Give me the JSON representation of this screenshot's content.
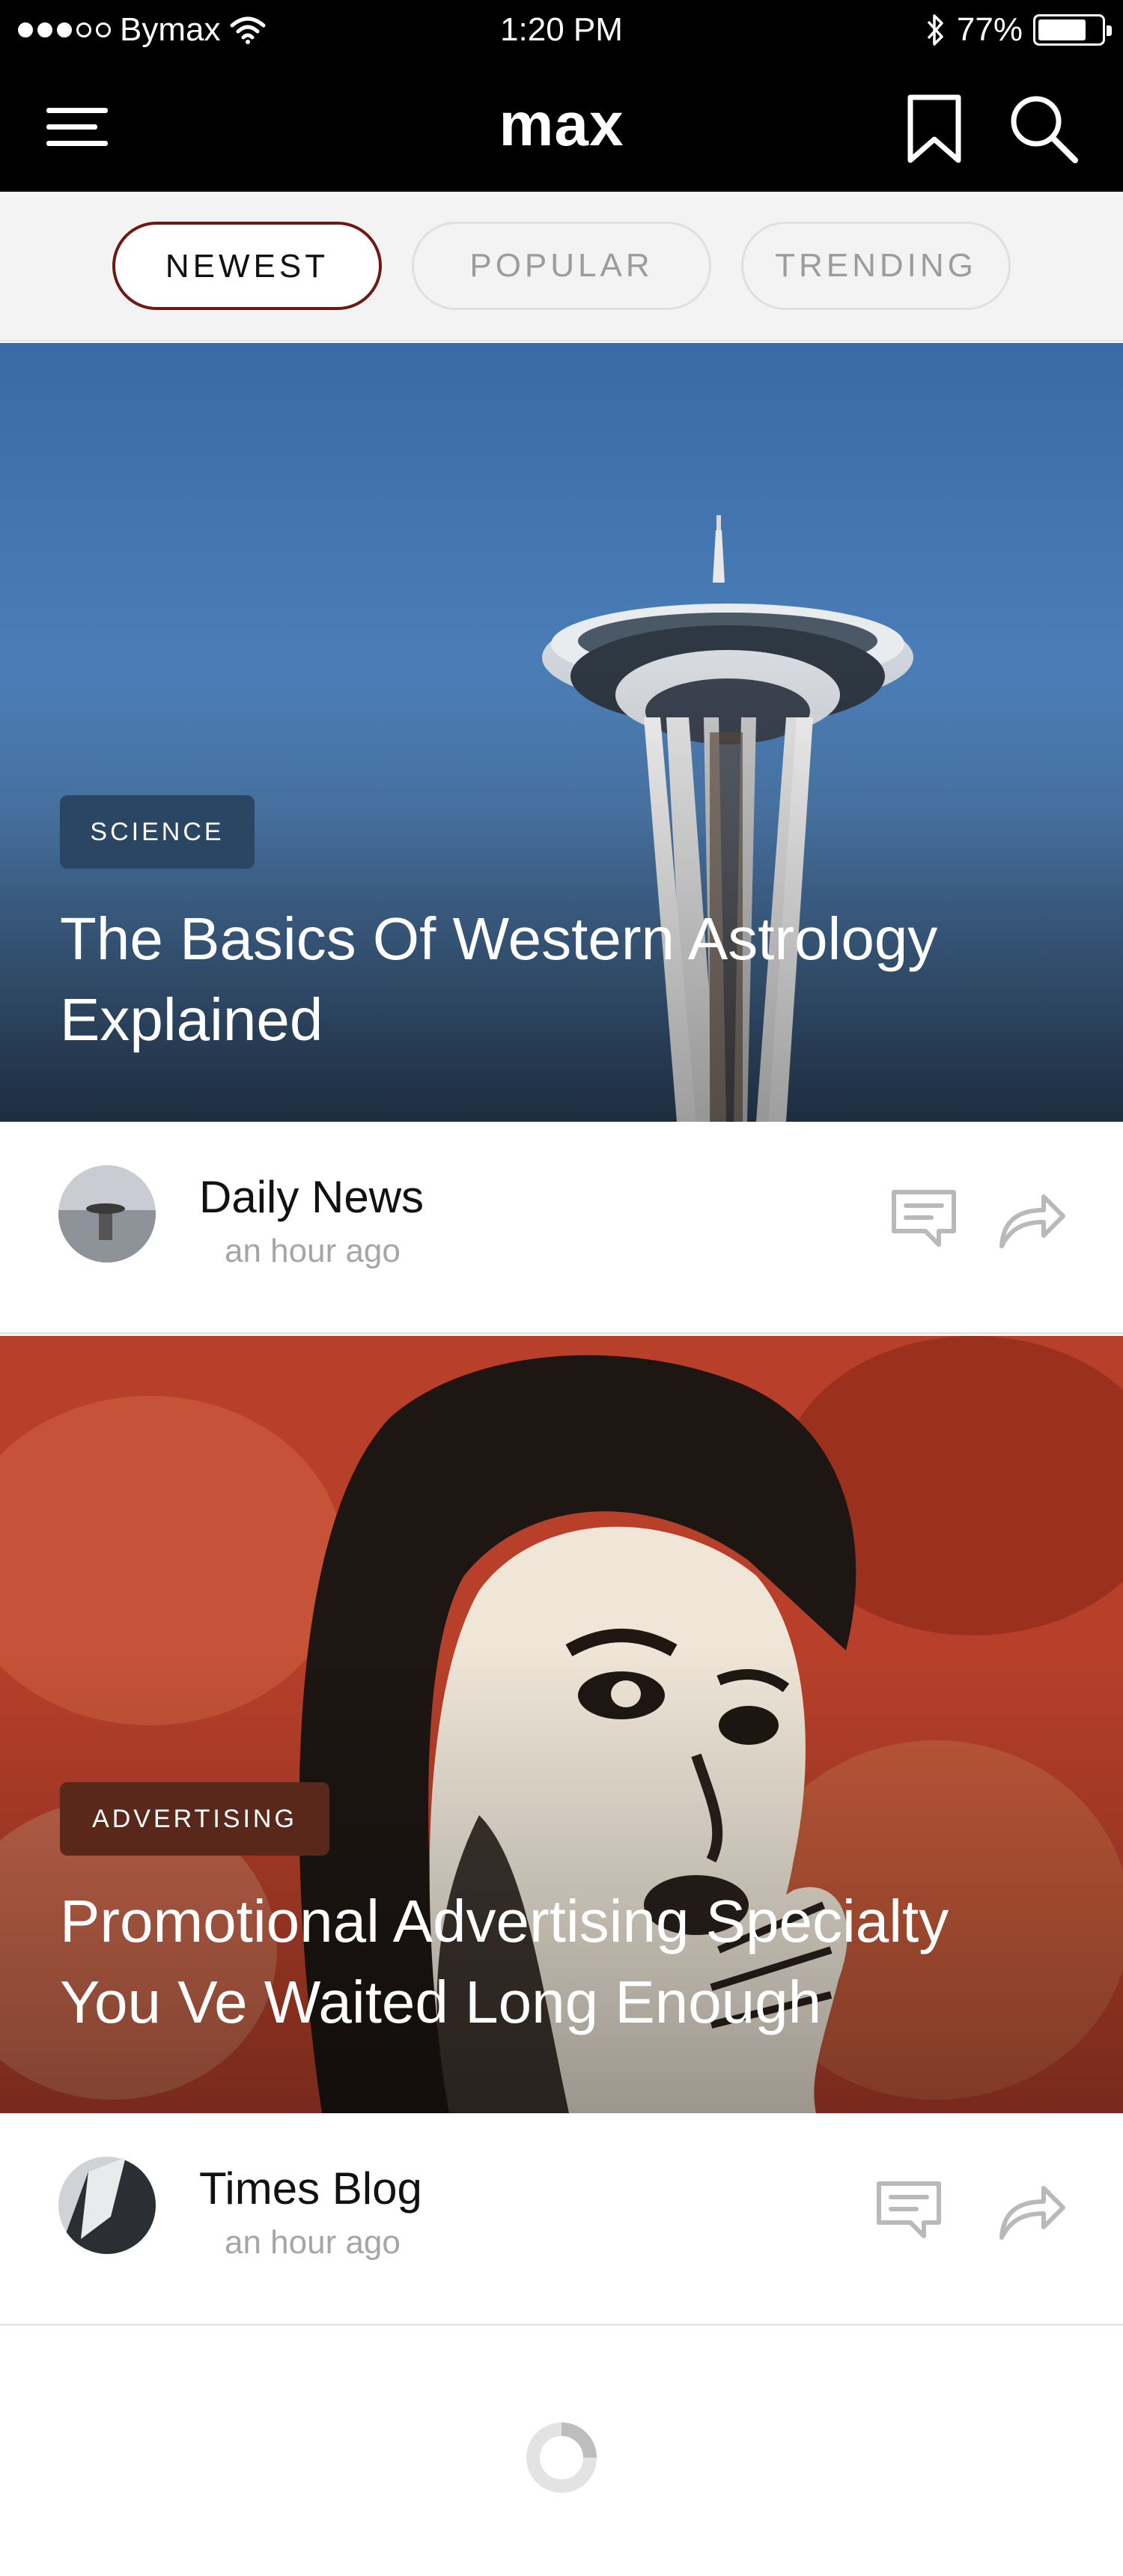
{
  "status_bar": {
    "carrier": "Bymax",
    "time": "1:20 PM",
    "battery_percent": "77%",
    "battery_level": 0.77
  },
  "nav": {
    "title": "max",
    "icons": [
      "menu-icon",
      "bookmark-icon",
      "search-icon"
    ]
  },
  "tabs": [
    {
      "label": "NEWEST",
      "active": true
    },
    {
      "label": "POPULAR",
      "active": false
    },
    {
      "label": "TRENDING",
      "active": false
    }
  ],
  "articles": [
    {
      "category": "SCIENCE",
      "title": "The Basics Of Western Astrology Explained",
      "source": "Daily News",
      "time": "an hour ago"
    },
    {
      "category": "ADVERTISING",
      "title": "Promotional Advertising Specialty You Ve Waited Long Enough",
      "source": "Times Blog",
      "time": "an hour ago"
    }
  ],
  "colors": {
    "accent": "#6e1a12",
    "header_bg": "#000000",
    "tabs_bg": "#f3f3f3",
    "muted_text": "#a6a6a6",
    "icon_gray": "#b9b9b9"
  }
}
